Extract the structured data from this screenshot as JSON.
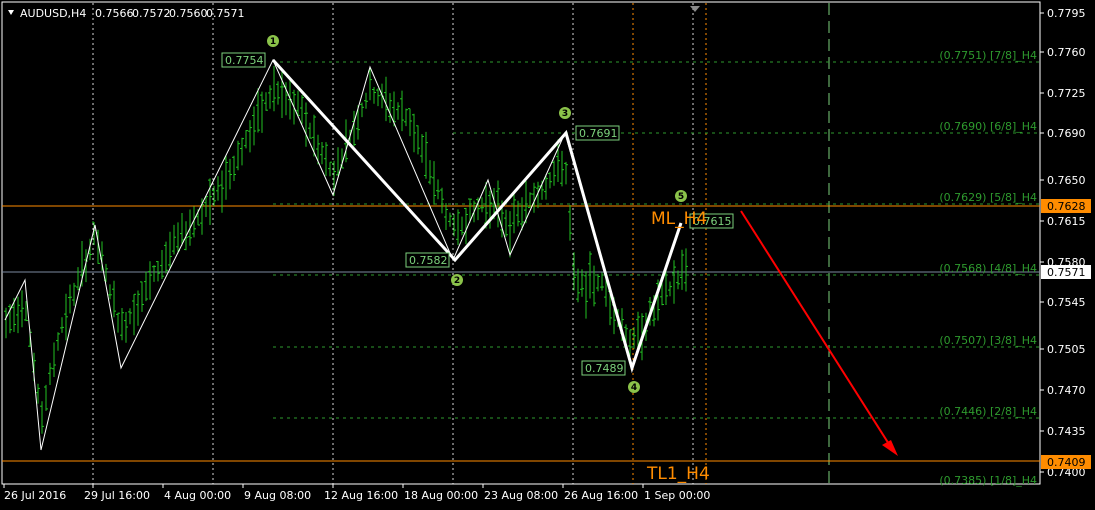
{
  "header": {
    "symbol": "AUDUSD,H4",
    "open": "0.7566",
    "high": "0.7572",
    "low": "0.7560",
    "close": "0.7571"
  },
  "price_axis": {
    "labels": [
      "0.7795",
      "0.7760",
      "0.7725",
      "0.7690",
      "0.7650",
      "0.7615",
      "0.7580",
      "0.7545",
      "0.7505",
      "0.7470",
      "0.7435",
      "0.7400"
    ],
    "current_price": "0.7571",
    "tags": [
      {
        "text": "0.7628",
        "color": "#ff8c00"
      },
      {
        "text": "0.7409",
        "color": "#ff8c00"
      }
    ]
  },
  "time_axis": {
    "labels": [
      "26 Jul 2016",
      "29 Jul 16:00",
      "4 Aug 00:00",
      "9 Aug 08:00",
      "12 Aug 16:00",
      "18 Aug 00:00",
      "23 Aug 08:00",
      "26 Aug 16:00",
      "1 Sep 00:00"
    ]
  },
  "murrey_levels": [
    {
      "text": "(0.7751) [7/8]_H4",
      "price": 0.7751
    },
    {
      "text": "(0.7690) [6/8]_H4",
      "price": 0.769
    },
    {
      "text": "(0.7629) [5/8]_H4",
      "price": 0.7629
    },
    {
      "text": "(0.7568) [4/8]_H4",
      "price": 0.7568
    },
    {
      "text": "(0.7507) [3/8]_H4",
      "price": 0.7507
    },
    {
      "text": "(0.7446) [2/8]_H4",
      "price": 0.7446
    },
    {
      "text": "(0.7385) [1/8]_H4",
      "price": 0.7385
    }
  ],
  "wave_labels": [
    {
      "text": "0.7754"
    },
    {
      "text": "0.7582"
    },
    {
      "text": "0.7691"
    },
    {
      "text": "0.7489"
    },
    {
      "text": "0.7615"
    }
  ],
  "wave_numbers": [
    "1",
    "2",
    "3",
    "4",
    "5"
  ],
  "annotations": {
    "ml_label": "ML_H4",
    "tl_label": "TL1_H4"
  },
  "colors": {
    "background": "#000000",
    "candles": "#22c022",
    "murrey": "#2e9a2e",
    "orange": "#ff8c00",
    "current_line": "#7b8aa0",
    "arrow": "#ff0000",
    "wave_circle": "#8bc34a"
  },
  "chart_data": {
    "type": "line",
    "series": [
      {
        "name": "zigzag",
        "x": [
          "26 Jul",
          "27 Jul",
          "28 Jul",
          "29 Jul",
          "1 Aug",
          "9 Aug",
          "11 Aug",
          "12 Aug",
          "18 Aug",
          "19 Aug",
          "22 Aug",
          "24 Aug",
          "25 Aug",
          "29 Aug",
          "31 Aug"
        ],
        "y": [
          0.7515,
          0.7565,
          0.742,
          0.761,
          0.7488,
          0.7754,
          0.764,
          0.775,
          0.7582,
          0.765,
          0.759,
          0.7691,
          0.7489,
          0.7489,
          0.7615
        ]
      }
    ],
    "ylim": [
      0.74,
      0.78
    ]
  }
}
